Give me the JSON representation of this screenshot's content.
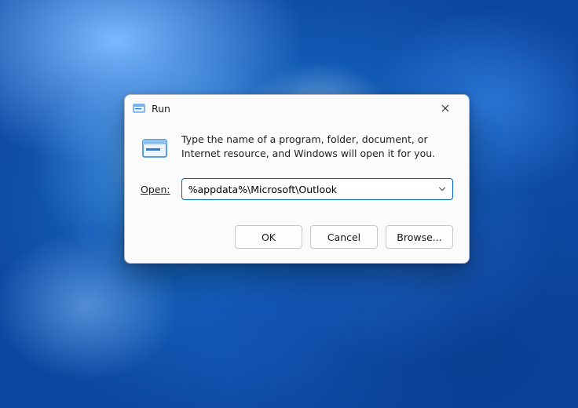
{
  "window": {
    "title": "Run"
  },
  "content": {
    "description": "Type the name of a program, folder, document, or Internet resource, and Windows will open it for you.",
    "open_label": "Open:",
    "open_value": "%appdata%\\Microsoft\\Outlook"
  },
  "buttons": {
    "ok": "OK",
    "cancel": "Cancel",
    "browse": "Browse..."
  },
  "icons": {
    "app": "run-dialog-icon",
    "close": "close-icon",
    "big": "run-large-icon",
    "chevron": "chevron-down-icon"
  },
  "colors": {
    "accent": "#0067c0"
  }
}
